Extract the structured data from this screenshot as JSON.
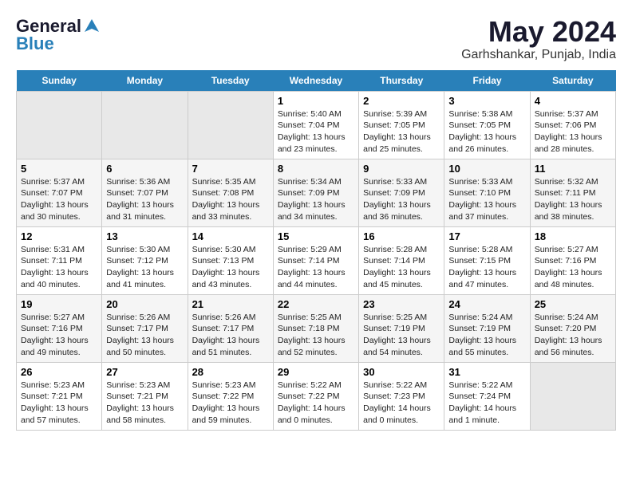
{
  "header": {
    "logo_line1": "General",
    "logo_line2": "Blue",
    "month_year": "May 2024",
    "location": "Garhshankar, Punjab, India"
  },
  "days": [
    "Sunday",
    "Monday",
    "Tuesday",
    "Wednesday",
    "Thursday",
    "Friday",
    "Saturday"
  ],
  "weeks": [
    [
      {
        "date": "",
        "info": ""
      },
      {
        "date": "",
        "info": ""
      },
      {
        "date": "",
        "info": ""
      },
      {
        "date": "1",
        "info": "Sunrise: 5:40 AM\nSunset: 7:04 PM\nDaylight: 13 hours\nand 23 minutes."
      },
      {
        "date": "2",
        "info": "Sunrise: 5:39 AM\nSunset: 7:05 PM\nDaylight: 13 hours\nand 25 minutes."
      },
      {
        "date": "3",
        "info": "Sunrise: 5:38 AM\nSunset: 7:05 PM\nDaylight: 13 hours\nand 26 minutes."
      },
      {
        "date": "4",
        "info": "Sunrise: 5:37 AM\nSunset: 7:06 PM\nDaylight: 13 hours\nand 28 minutes."
      }
    ],
    [
      {
        "date": "5",
        "info": "Sunrise: 5:37 AM\nSunset: 7:07 PM\nDaylight: 13 hours\nand 30 minutes."
      },
      {
        "date": "6",
        "info": "Sunrise: 5:36 AM\nSunset: 7:07 PM\nDaylight: 13 hours\nand 31 minutes."
      },
      {
        "date": "7",
        "info": "Sunrise: 5:35 AM\nSunset: 7:08 PM\nDaylight: 13 hours\nand 33 minutes."
      },
      {
        "date": "8",
        "info": "Sunrise: 5:34 AM\nSunset: 7:09 PM\nDaylight: 13 hours\nand 34 minutes."
      },
      {
        "date": "9",
        "info": "Sunrise: 5:33 AM\nSunset: 7:09 PM\nDaylight: 13 hours\nand 36 minutes."
      },
      {
        "date": "10",
        "info": "Sunrise: 5:33 AM\nSunset: 7:10 PM\nDaylight: 13 hours\nand 37 minutes."
      },
      {
        "date": "11",
        "info": "Sunrise: 5:32 AM\nSunset: 7:11 PM\nDaylight: 13 hours\nand 38 minutes."
      }
    ],
    [
      {
        "date": "12",
        "info": "Sunrise: 5:31 AM\nSunset: 7:11 PM\nDaylight: 13 hours\nand 40 minutes."
      },
      {
        "date": "13",
        "info": "Sunrise: 5:30 AM\nSunset: 7:12 PM\nDaylight: 13 hours\nand 41 minutes."
      },
      {
        "date": "14",
        "info": "Sunrise: 5:30 AM\nSunset: 7:13 PM\nDaylight: 13 hours\nand 43 minutes."
      },
      {
        "date": "15",
        "info": "Sunrise: 5:29 AM\nSunset: 7:14 PM\nDaylight: 13 hours\nand 44 minutes."
      },
      {
        "date": "16",
        "info": "Sunrise: 5:28 AM\nSunset: 7:14 PM\nDaylight: 13 hours\nand 45 minutes."
      },
      {
        "date": "17",
        "info": "Sunrise: 5:28 AM\nSunset: 7:15 PM\nDaylight: 13 hours\nand 47 minutes."
      },
      {
        "date": "18",
        "info": "Sunrise: 5:27 AM\nSunset: 7:16 PM\nDaylight: 13 hours\nand 48 minutes."
      }
    ],
    [
      {
        "date": "19",
        "info": "Sunrise: 5:27 AM\nSunset: 7:16 PM\nDaylight: 13 hours\nand 49 minutes."
      },
      {
        "date": "20",
        "info": "Sunrise: 5:26 AM\nSunset: 7:17 PM\nDaylight: 13 hours\nand 50 minutes."
      },
      {
        "date": "21",
        "info": "Sunrise: 5:26 AM\nSunset: 7:17 PM\nDaylight: 13 hours\nand 51 minutes."
      },
      {
        "date": "22",
        "info": "Sunrise: 5:25 AM\nSunset: 7:18 PM\nDaylight: 13 hours\nand 52 minutes."
      },
      {
        "date": "23",
        "info": "Sunrise: 5:25 AM\nSunset: 7:19 PM\nDaylight: 13 hours\nand 54 minutes."
      },
      {
        "date": "24",
        "info": "Sunrise: 5:24 AM\nSunset: 7:19 PM\nDaylight: 13 hours\nand 55 minutes."
      },
      {
        "date": "25",
        "info": "Sunrise: 5:24 AM\nSunset: 7:20 PM\nDaylight: 13 hours\nand 56 minutes."
      }
    ],
    [
      {
        "date": "26",
        "info": "Sunrise: 5:23 AM\nSunset: 7:21 PM\nDaylight: 13 hours\nand 57 minutes."
      },
      {
        "date": "27",
        "info": "Sunrise: 5:23 AM\nSunset: 7:21 PM\nDaylight: 13 hours\nand 58 minutes."
      },
      {
        "date": "28",
        "info": "Sunrise: 5:23 AM\nSunset: 7:22 PM\nDaylight: 13 hours\nand 59 minutes."
      },
      {
        "date": "29",
        "info": "Sunrise: 5:22 AM\nSunset: 7:22 PM\nDaylight: 14 hours\nand 0 minutes."
      },
      {
        "date": "30",
        "info": "Sunrise: 5:22 AM\nSunset: 7:23 PM\nDaylight: 14 hours\nand 0 minutes."
      },
      {
        "date": "31",
        "info": "Sunrise: 5:22 AM\nSunset: 7:24 PM\nDaylight: 14 hours\nand 1 minute."
      },
      {
        "date": "",
        "info": ""
      }
    ]
  ]
}
